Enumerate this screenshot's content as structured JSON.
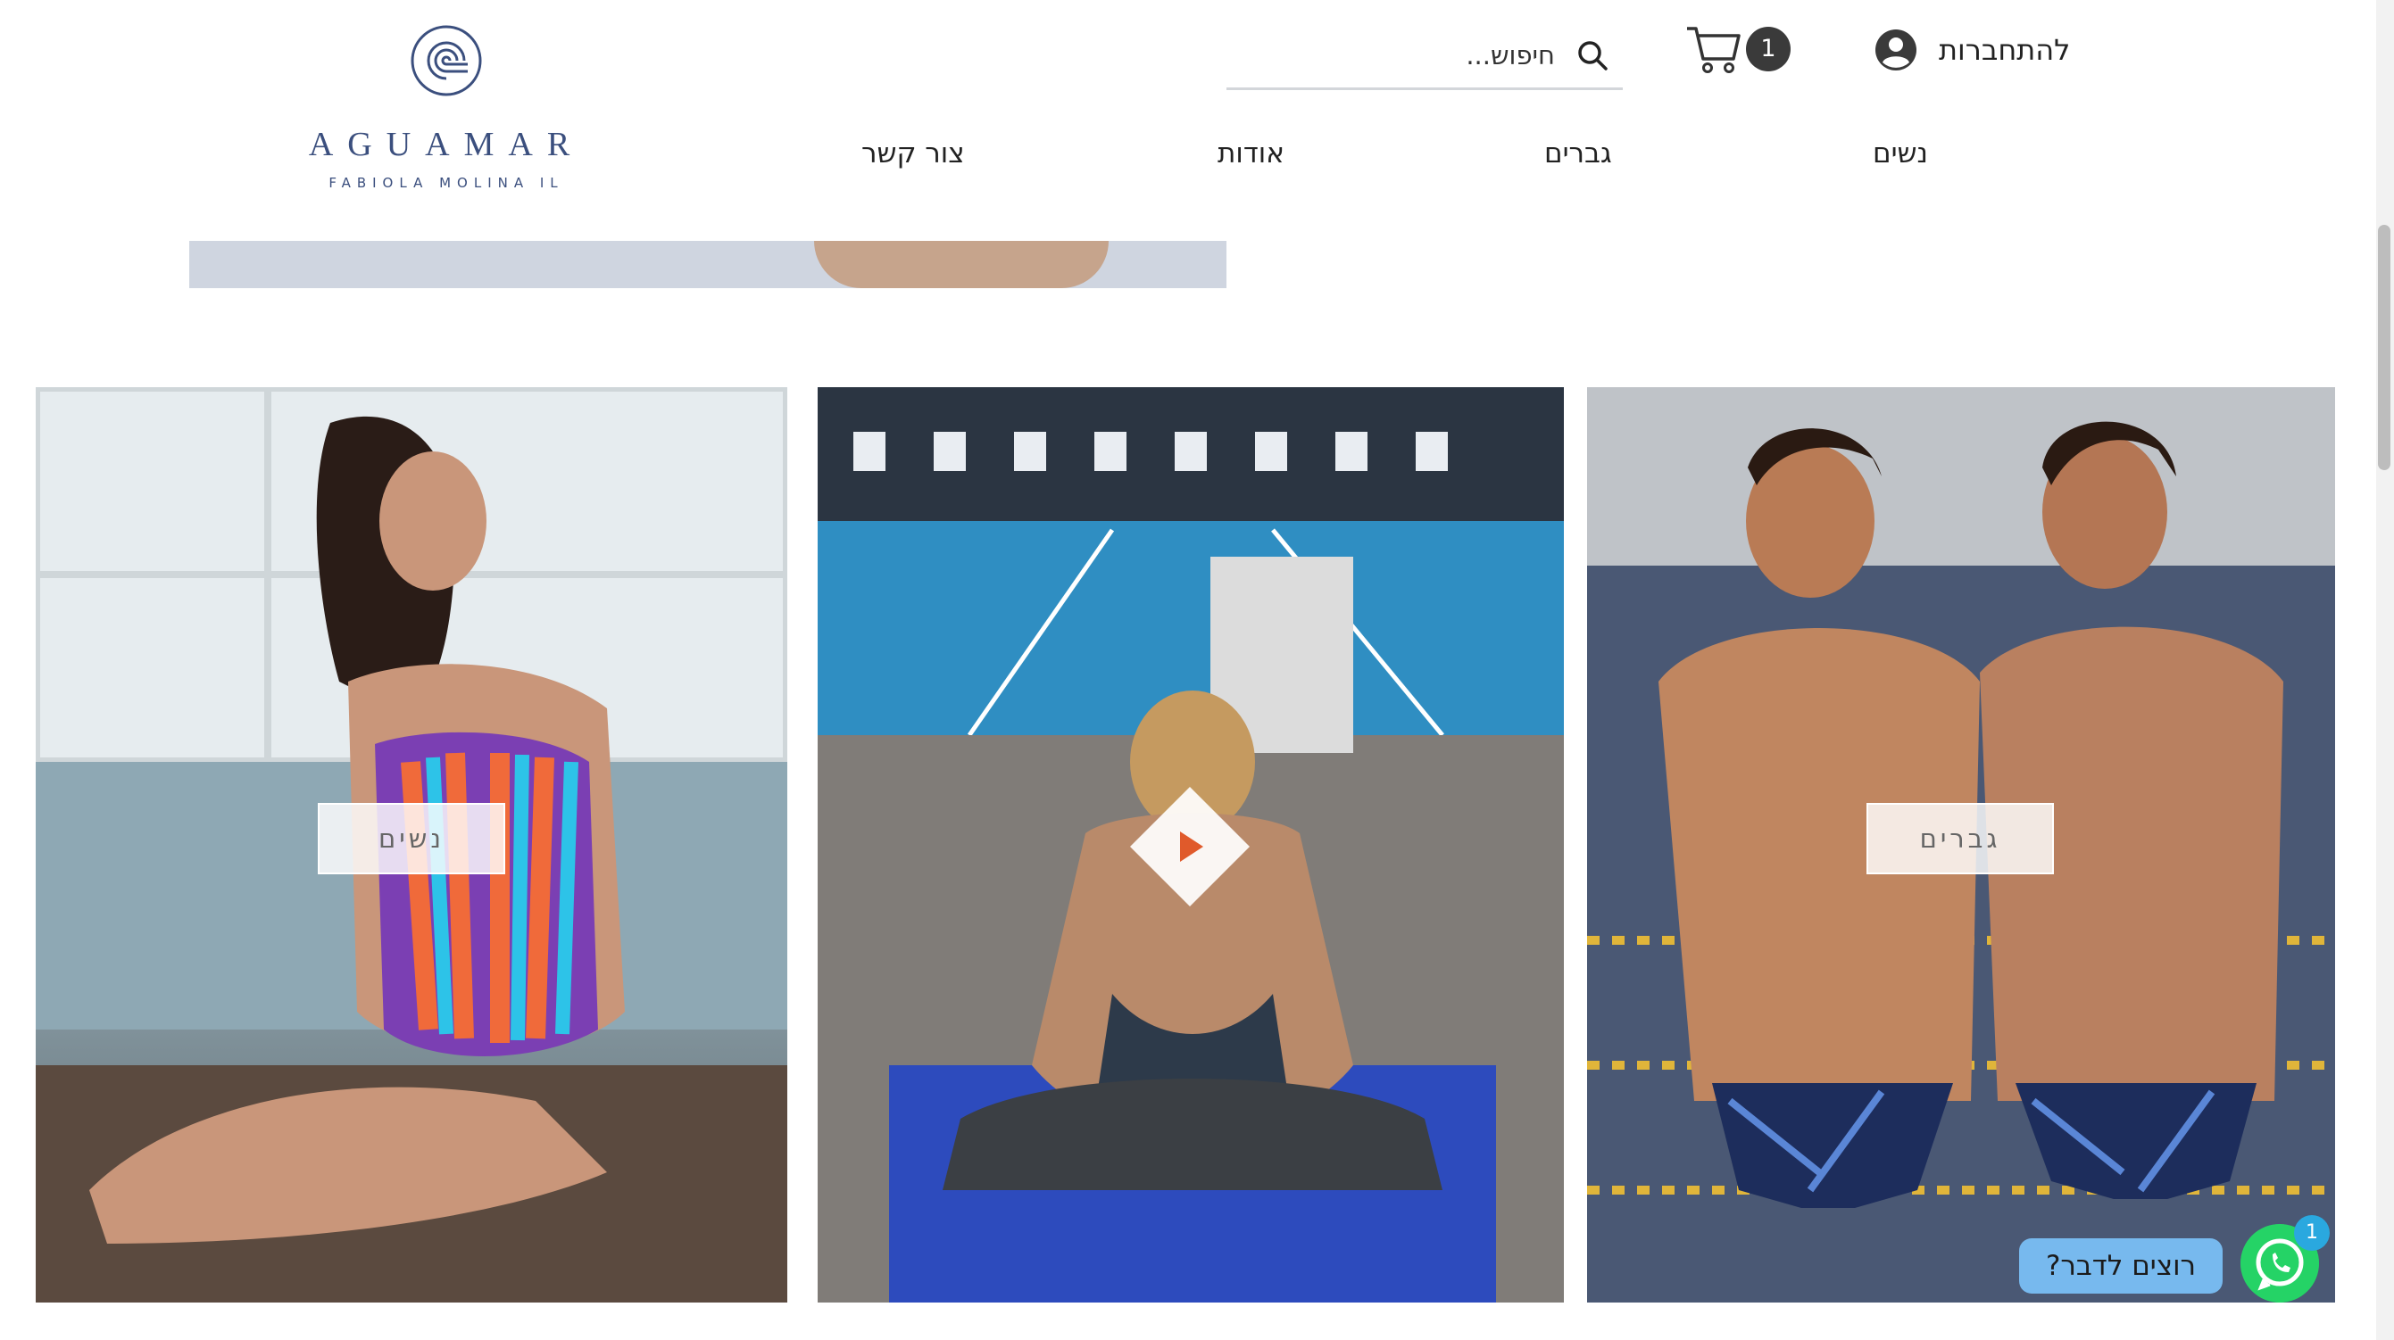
{
  "brand": {
    "name": "AGUAMAR",
    "tagline": "FABIOLA MOLINA IL",
    "color": "#3b4f7e"
  },
  "header": {
    "search_placeholder": "חיפוש...",
    "cart_count": "1",
    "login_label": "להתחברות"
  },
  "nav": {
    "items": [
      "נשים",
      "גברים",
      "אודות",
      "צור קשר"
    ]
  },
  "tiles": {
    "women_button": "נשים",
    "men_button": "גברים"
  },
  "chat": {
    "prompt": "רוצים לדבר?",
    "badge": "1",
    "color": "#25d366"
  },
  "icons": [
    "search-icon",
    "cart-icon",
    "avatar-icon",
    "play-icon",
    "whatsapp-icon"
  ]
}
